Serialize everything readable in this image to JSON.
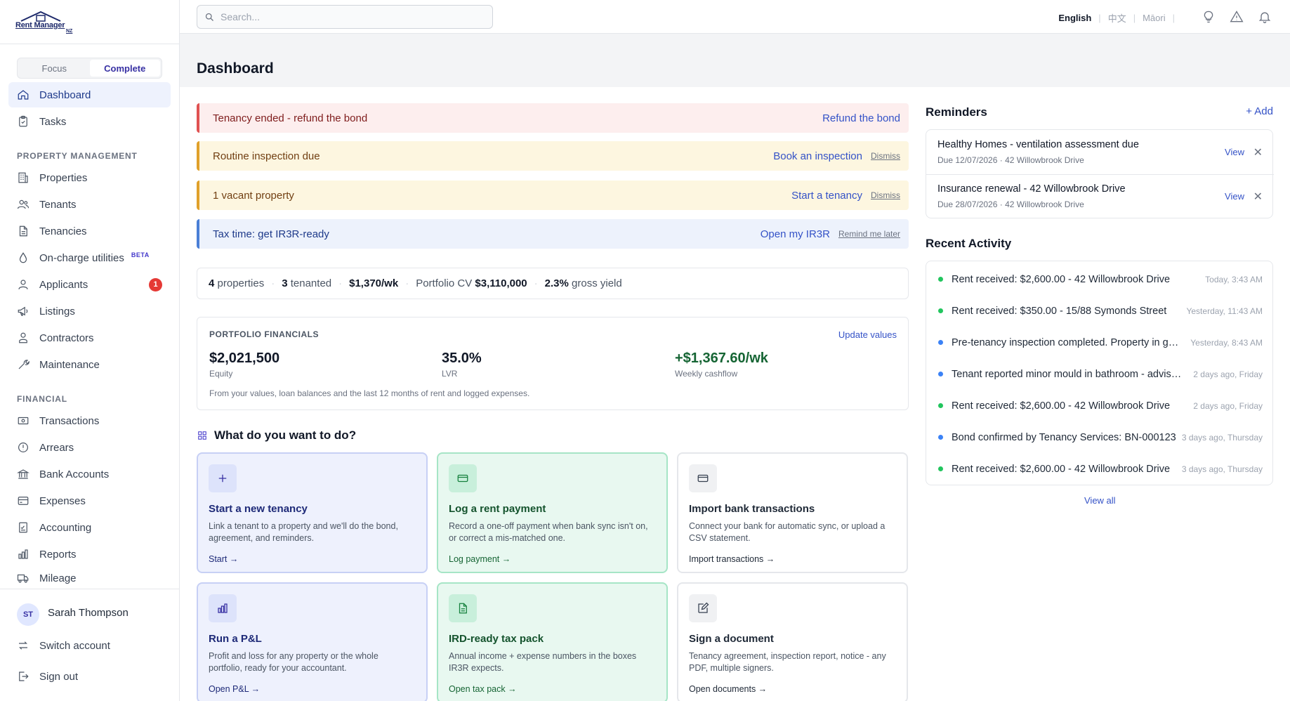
{
  "brand": {
    "name": "Rent Manager",
    "suffix": "NZ"
  },
  "mode_toggle": {
    "focus": "Focus",
    "complete": "Complete"
  },
  "nav": {
    "top": [
      {
        "label": "Dashboard",
        "icon": "home-icon"
      },
      {
        "label": "Tasks",
        "icon": "clipboard-icon"
      }
    ],
    "property_heading": "PROPERTY MANAGEMENT",
    "property": [
      {
        "label": "Properties",
        "icon": "building-icon"
      },
      {
        "label": "Tenants",
        "icon": "users-icon"
      },
      {
        "label": "Tenancies",
        "icon": "document-icon"
      },
      {
        "label": "On-charge utilities",
        "icon": "droplet-icon",
        "tag": "BETA"
      },
      {
        "label": "Applicants",
        "icon": "user-icon",
        "badge": "1"
      },
      {
        "label": "Listings",
        "icon": "megaphone-icon"
      },
      {
        "label": "Contractors",
        "icon": "person-icon"
      },
      {
        "label": "Maintenance",
        "icon": "wrench-icon"
      }
    ],
    "financial_heading": "FINANCIAL",
    "financial": [
      {
        "label": "Transactions",
        "icon": "cash-icon"
      },
      {
        "label": "Arrears",
        "icon": "alert-circle-icon"
      },
      {
        "label": "Bank Accounts",
        "icon": "bank-icon"
      },
      {
        "label": "Expenses",
        "icon": "card-icon"
      },
      {
        "label": "Accounting",
        "icon": "ledger-icon"
      },
      {
        "label": "Reports",
        "icon": "bar-chart-icon"
      },
      {
        "label": "Mileage",
        "icon": "truck-icon"
      }
    ]
  },
  "user": {
    "initials": "ST",
    "name": "Sarah Thompson",
    "switch": "Switch account",
    "signout": "Sign out"
  },
  "search": {
    "placeholder": "Search..."
  },
  "languages": {
    "english": "English",
    "chinese": "中文",
    "maori": "Māori"
  },
  "page": {
    "title": "Dashboard"
  },
  "alerts": [
    {
      "text": "Tenancy ended - refund the bond",
      "action": "Refund the bond",
      "secondary": ""
    },
    {
      "text": "Routine inspection due",
      "action": "Book an inspection",
      "secondary": "Dismiss"
    },
    {
      "text": "1 vacant property",
      "action": "Start a tenancy",
      "secondary": "Dismiss"
    },
    {
      "text": "Tax time: get IR3R-ready",
      "action": "Open my IR3R",
      "secondary": "Remind me later"
    }
  ],
  "stats": {
    "properties_n": "4",
    "properties_l": "properties",
    "tenanted_n": "3",
    "tenanted_l": "tenanted",
    "rent": "$1,370/wk",
    "cv_l": "Portfolio CV",
    "cv_v": "$3,110,000",
    "yield_v": "2.3%",
    "yield_l": "gross yield"
  },
  "financials": {
    "heading": "PORTFOLIO FINANCIALS",
    "update": "Update values",
    "equity_v": "$2,021,500",
    "equity_l": "Equity",
    "lvr_v": "35.0%",
    "lvr_l": "LVR",
    "cash_v": "+$1,367.60/wk",
    "cash_l": "Weekly cashflow",
    "note": "From your values, loan balances and the last 12 months of rent and logged expenses."
  },
  "actions_heading": "What do you want to do?",
  "action_cards": [
    {
      "title": "Start a new tenancy",
      "desc": "Link a tenant to a property and we'll do the bond, agreement, and reminders.",
      "link": "Start →"
    },
    {
      "title": "Log a rent payment",
      "desc": "Record a one-off payment when bank sync isn't on, or correct a mis-matched one.",
      "link": "Log payment →"
    },
    {
      "title": "Import bank transactions",
      "desc": "Connect your bank for automatic sync, or upload a CSV statement.",
      "link": "Import transactions →"
    },
    {
      "title": "Run a P&L",
      "desc": "Profit and loss for any property or the whole portfolio, ready for your accountant.",
      "link": "Open P&L →"
    },
    {
      "title": "IRD-ready tax pack",
      "desc": "Annual income + expense numbers in the boxes IR3R expects.",
      "link": "Open tax pack →"
    },
    {
      "title": "Sign a document",
      "desc": "Tenancy agreement, inspection report, notice - any PDF, multiple signers.",
      "link": "Open documents →"
    }
  ],
  "reminders": {
    "heading": "Reminders",
    "add": "+ Add",
    "items": [
      {
        "title": "Healthy Homes - ventilation assessment due",
        "sub": "Due 12/07/2026 · 42 Willowbrook Drive",
        "view": "View"
      },
      {
        "title": "Insurance renewal - 42 Willowbrook Drive",
        "sub": "Due 28/07/2026 · 42 Willowbrook Drive",
        "view": "View"
      }
    ]
  },
  "activity": {
    "heading": "Recent Activity",
    "view_all": "View all",
    "colors": {
      "green": "#22c55e",
      "blue": "#3b82f6"
    },
    "items": [
      {
        "text": "Rent received: $2,600.00 - 42 Willowbrook Drive",
        "when": "Today, 3:43 AM",
        "kind": "green"
      },
      {
        "text": "Rent received: $350.00 - 15/88 Symonds Street",
        "when": "Yesterday, 11:43 AM",
        "kind": "green"
      },
      {
        "text": "Pre-tenancy inspection completed. Property in good condition.",
        "when": "Yesterday, 8:43 AM",
        "kind": "blue"
      },
      {
        "text": "Tenant reported minor mould in bathroom - advised on ventilation",
        "when": "2 days ago, Friday",
        "kind": "blue"
      },
      {
        "text": "Rent received: $2,600.00 - 42 Willowbrook Drive",
        "when": "2 days ago, Friday",
        "kind": "green"
      },
      {
        "text": "Bond confirmed by Tenancy Services: BN-000123",
        "when": "3 days ago, Thursday",
        "kind": "blue"
      },
      {
        "text": "Rent received: $2,600.00 - 42 Willowbrook Drive",
        "when": "3 days ago, Thursday",
        "kind": "green"
      }
    ]
  }
}
